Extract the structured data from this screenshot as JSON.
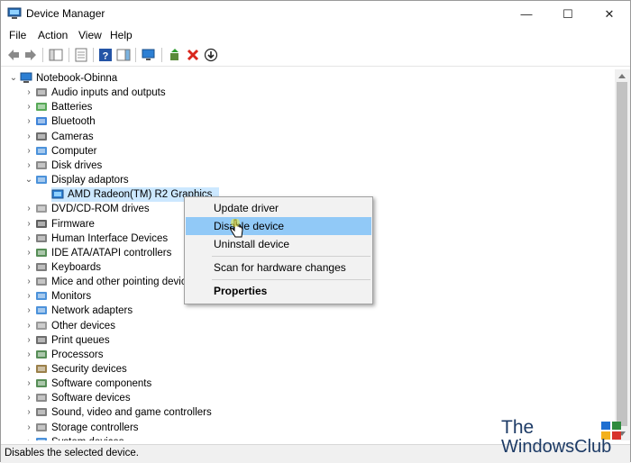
{
  "window": {
    "title": "Device Manager",
    "minimize": "—",
    "maximize": "☐",
    "close": "✕"
  },
  "menu": [
    "File",
    "Action",
    "View",
    "Help"
  ],
  "tree": {
    "root": "Notebook-Obinna",
    "categories": [
      "Audio inputs and outputs",
      "Batteries",
      "Bluetooth",
      "Cameras",
      "Computer",
      "Disk drives",
      "Display adaptors",
      "DVD/CD-ROM drives",
      "Firmware",
      "Human Interface Devices",
      "IDE ATA/ATAPI controllers",
      "Keyboards",
      "Mice and other pointing devices",
      "Monitors",
      "Network adapters",
      "Other devices",
      "Print queues",
      "Processors",
      "Security devices",
      "Software components",
      "Software devices",
      "Sound, video and game controllers",
      "Storage controllers",
      "System devices"
    ],
    "expanded_child": "AMD Radeon(TM) R2 Graphics"
  },
  "context_menu": {
    "items": [
      "Update driver",
      "Disable device",
      "Uninstall device",
      "Scan for hardware changes",
      "Properties"
    ],
    "highlighted": "Disable device"
  },
  "status_bar": "Disables the selected device.",
  "watermark": {
    "line1": "The",
    "line2": "WindowsClub"
  },
  "colors": {
    "selection": "#cce8ff",
    "menu_highlight": "#91c9f7",
    "remove_red": "#d9261c"
  }
}
